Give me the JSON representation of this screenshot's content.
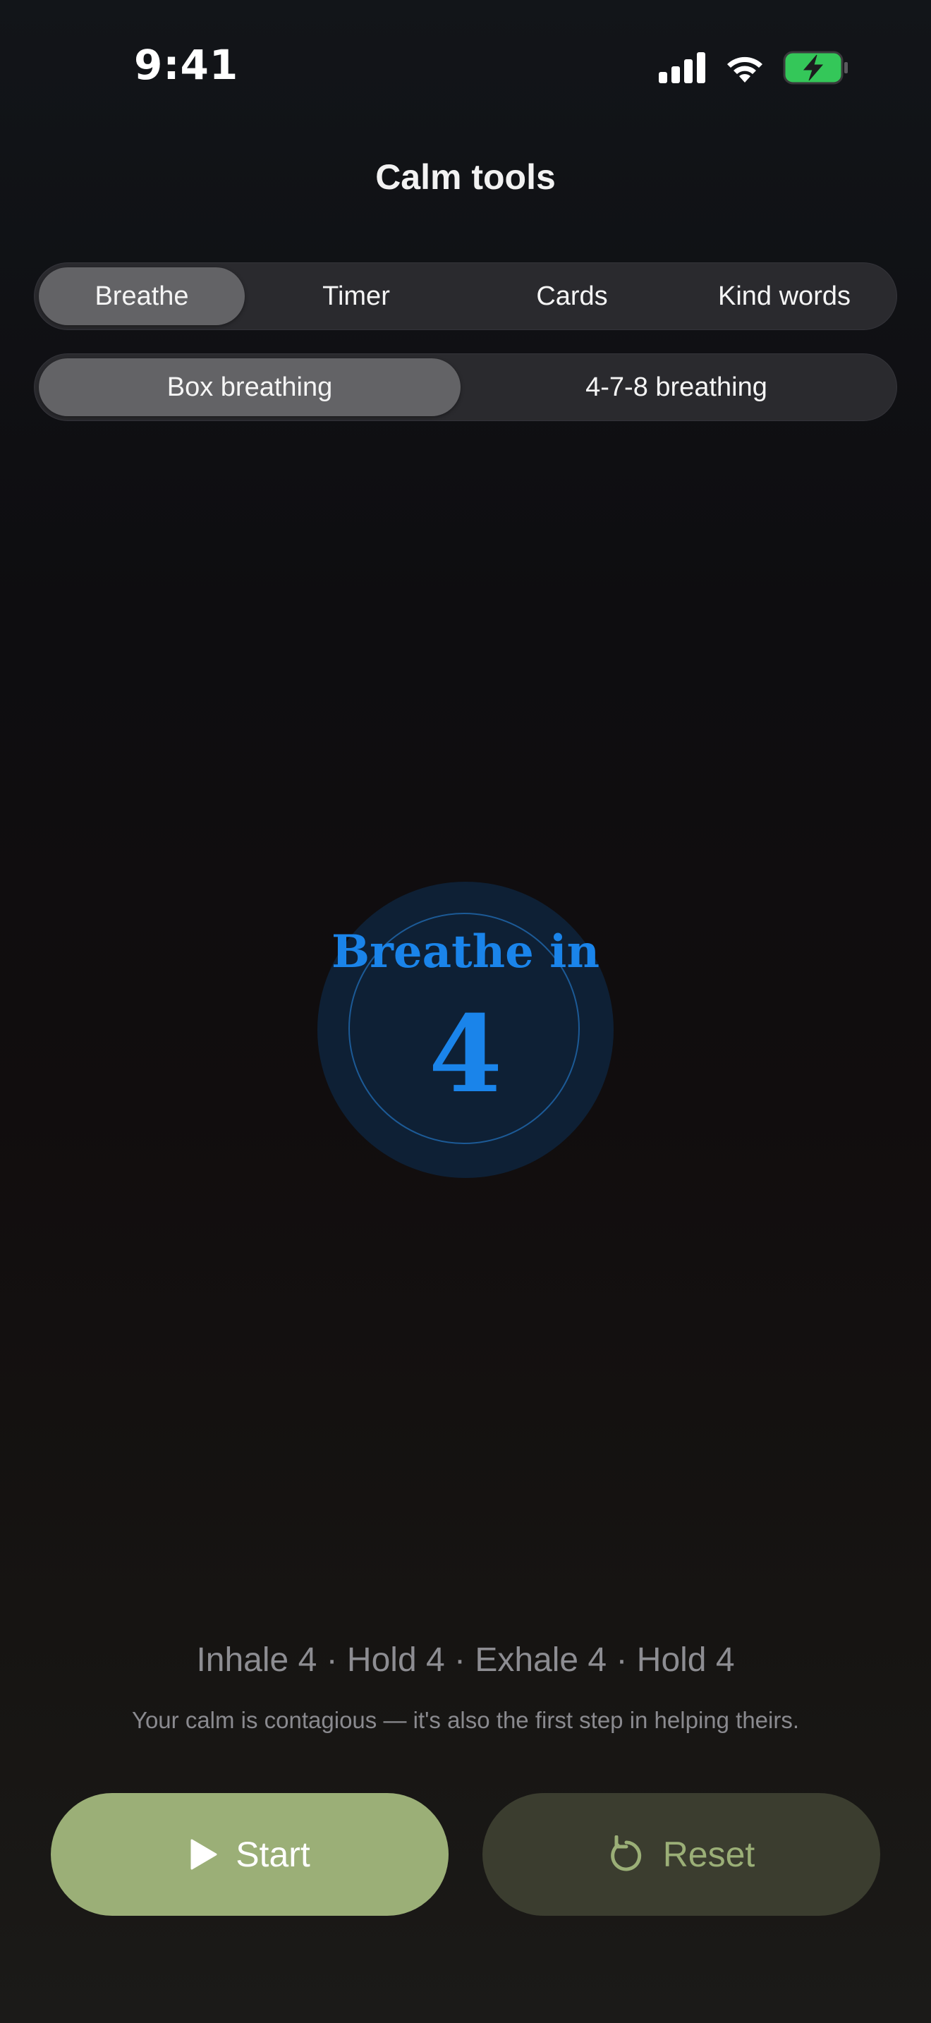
{
  "status_bar": {
    "time": "9:41"
  },
  "nav": {
    "title": "Calm tools"
  },
  "tabs": [
    {
      "label": "Breathe",
      "selected": true
    },
    {
      "label": "Timer",
      "selected": false
    },
    {
      "label": "Cards",
      "selected": false
    },
    {
      "label": "Kind words",
      "selected": false
    }
  ],
  "breathing_modes": [
    {
      "label": "Box breathing",
      "selected": true
    },
    {
      "label": "4-7-8 breathing",
      "selected": false
    }
  ],
  "breath": {
    "phase": "Breathe in",
    "count": "4"
  },
  "pattern": "Inhale 4 · Hold 4 · Exhale 4 · Hold 4",
  "caption": "Your calm is contagious — it's also the first step in helping theirs.",
  "buttons": {
    "start_label": "Start",
    "start_icon": "play-icon",
    "reset_label": "Reset",
    "reset_icon": "reset-icon"
  },
  "colors": {
    "accent_blue": "#1a84ea",
    "start_green": "#9baf77",
    "reset_bg": "#3b3d2f",
    "battery_green": "#34c759"
  },
  "icons": {
    "signal": "cellular-signal-icon",
    "wifi": "wifi-icon",
    "battery": "battery-charging-icon"
  }
}
